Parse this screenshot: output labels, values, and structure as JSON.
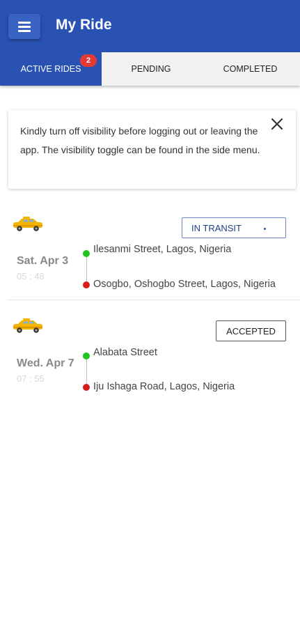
{
  "app": {
    "title": "My Ride"
  },
  "tabs": [
    {
      "label": "ACTIVE RIDES",
      "badge": "2",
      "active": true
    },
    {
      "label": "PENDING",
      "active": false
    },
    {
      "label": "COMPLETED",
      "active": false
    }
  ],
  "notice": {
    "text": "Kindly turn off visibility before logging out or leaving the app. The visibility toggle can be found in the side menu."
  },
  "rides": [
    {
      "status": "IN TRANSIT",
      "date": "Sat. Apr 3",
      "time": "05 : 48",
      "pickup": "Ilesanmi Street, Lagos, Nigeria",
      "dropoff": "Osogbo, Oshogbo Street, Lagos, Nigeria"
    },
    {
      "status": "ACCEPTED",
      "date": "Wed. Apr 7",
      "time": "07 : 55",
      "pickup": "Alabata Street",
      "dropoff": "Iju Ishaga Road, Lagos, Nigeria"
    }
  ],
  "colors": {
    "primary": "#2952b3",
    "pickup_pin": "#22c31f",
    "dropoff_pin": "#d81b1b",
    "badge": "#e53935",
    "taxi": "#f4b400"
  },
  "icons": [
    "menu-icon",
    "close-icon",
    "taxi-icon"
  ]
}
